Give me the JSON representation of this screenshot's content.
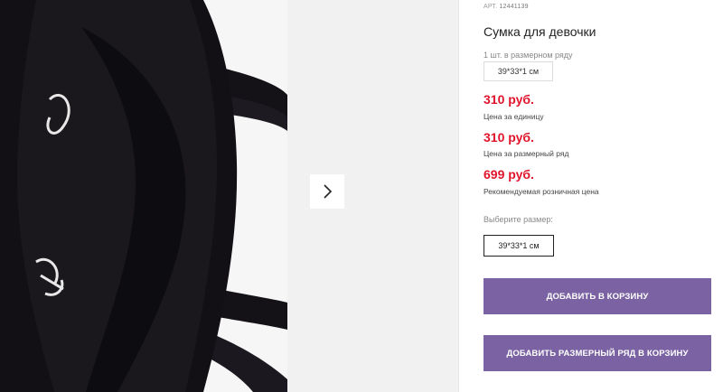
{
  "gallery": {
    "photo_alt": "black tote bag",
    "next_icon": "chevron-right-icon"
  },
  "product": {
    "sku_label": "АРТ.",
    "sku_value": "12441139",
    "title": "Сумка для девочки",
    "qty_note": "1 шт. в размерном ряду",
    "size_static": "39*33*1 см",
    "prices": [
      {
        "value": "310 руб.",
        "label": "Цена за единицу"
      },
      {
        "value": "310 руб.",
        "label": "Цена за размерный ряд"
      },
      {
        "value": "699 руб.",
        "label": "Рекомендуемая розничная цена"
      }
    ],
    "choose_size_label": "Выберите размер:",
    "selected_size": "39*33*1 см"
  },
  "actions": {
    "add_to_cart": "ДОБАВИТЬ В КОРЗИНУ",
    "add_series_to_cart": "ДОБАВИТЬ РАЗМЕРНЫЙ РЯД В КОРЗИНУ"
  },
  "colors": {
    "price_red": "#e0142b",
    "button_purple": "#7b63a3"
  }
}
